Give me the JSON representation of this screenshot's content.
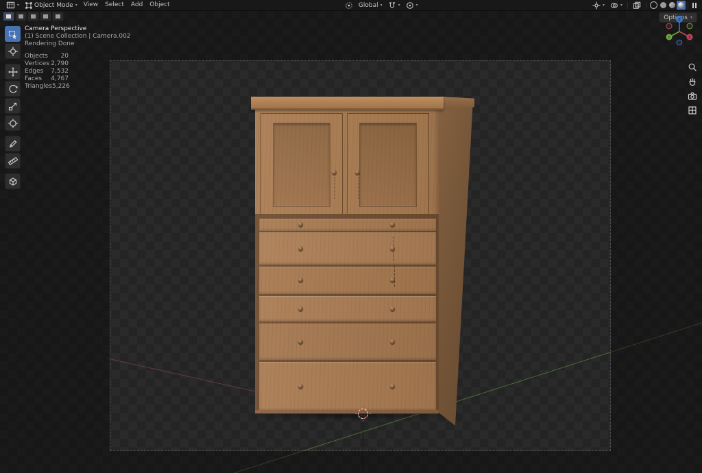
{
  "header": {
    "mode_label": "Object Mode",
    "menus": [
      {
        "label": "View"
      },
      {
        "label": "Select"
      },
      {
        "label": "Add"
      },
      {
        "label": "Object"
      }
    ],
    "orientation_label": "Global",
    "options_label": "Options"
  },
  "viewport_overlay": {
    "view_name": "Camera Perspective",
    "breadcrumb": "(1) Scene Collection | Camera.002",
    "status": "Rendering Done",
    "stats": [
      {
        "label": "Objects",
        "value": "20"
      },
      {
        "label": "Vertices",
        "value": "2,790"
      },
      {
        "label": "Edges",
        "value": "7,532"
      },
      {
        "label": "Faces",
        "value": "4,767"
      },
      {
        "label": "Triangles",
        "value": "5,226"
      }
    ]
  },
  "toolbar": {
    "tools": [
      "select-box",
      "cursor",
      "move",
      "rotate",
      "scale",
      "transform",
      "annotate",
      "measure",
      "add-cube"
    ]
  },
  "shading_modes": [
    "wireframe",
    "solid",
    "material-preview",
    "rendered"
  ],
  "active_shading": "rendered",
  "colors": {
    "accent": "#4772b3",
    "axis_x": "#c3445a",
    "axis_y": "#71a93f",
    "axis_z": "#3b76cc",
    "wood": "#a87b52",
    "viewport_bg": "#232323"
  }
}
